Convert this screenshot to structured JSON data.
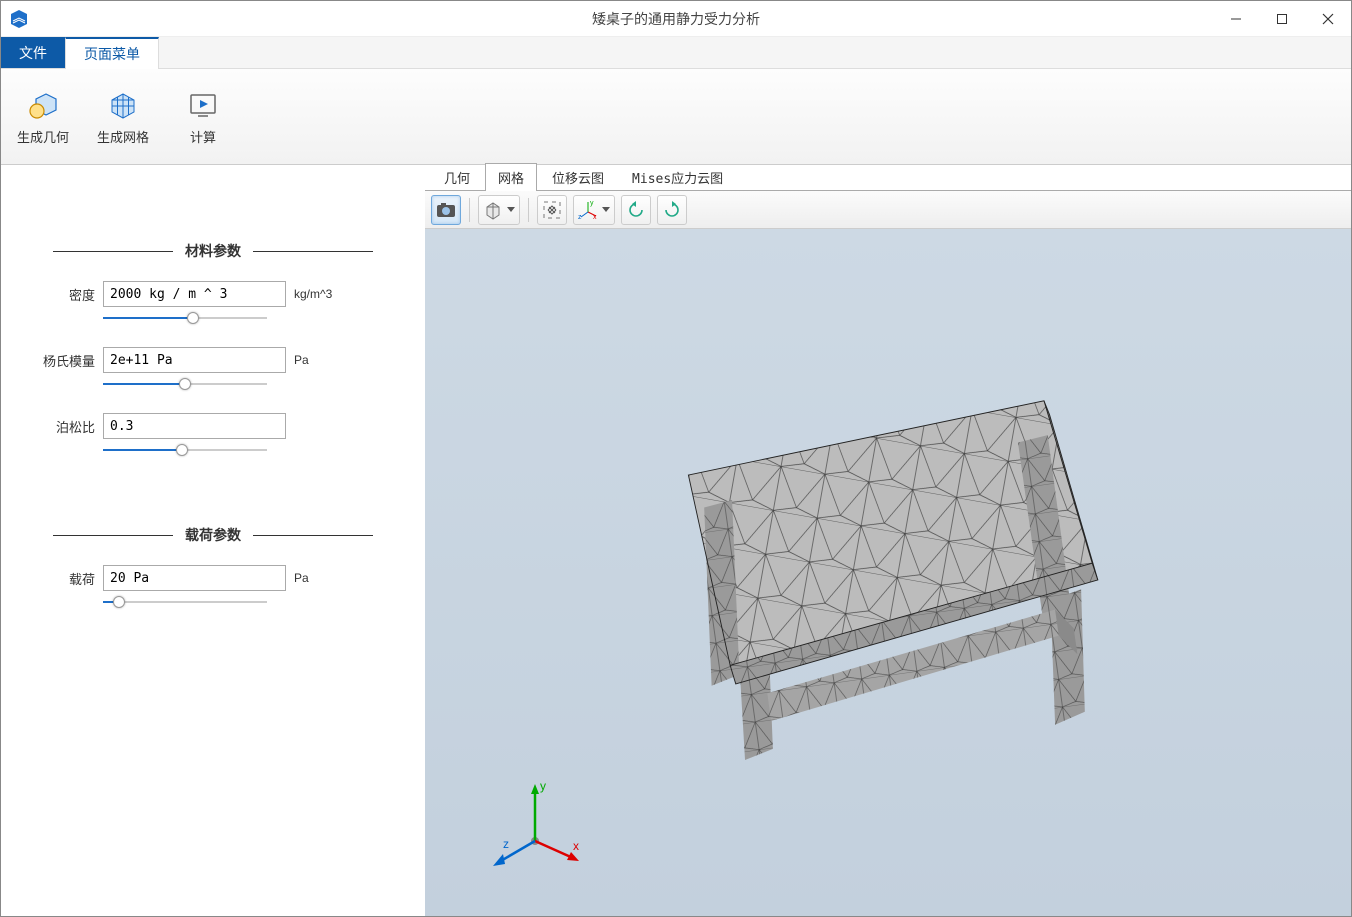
{
  "window": {
    "title": "矮桌子的通用静力受力分析"
  },
  "menu_tabs": {
    "file": "文件",
    "page_menu": "页面菜单"
  },
  "ribbon": {
    "generate_geometry": "生成几何",
    "generate_mesh": "生成网格",
    "compute": "计算"
  },
  "sidebar": {
    "material_params": {
      "header": "材料参数",
      "density": {
        "label": "密度",
        "value": "2000 kg / m ^ 3",
        "unit": "kg/m^3",
        "slider_fill_pct": 55
      },
      "youngs_modulus": {
        "label": "杨氏模量",
        "value": "2e+11 Pa",
        "unit": "Pa",
        "slider_fill_pct": 50
      },
      "poisson_ratio": {
        "label": "泊松比",
        "value": "0.3",
        "unit": "",
        "slider_fill_pct": 48
      }
    },
    "load_params": {
      "header": "载荷参数",
      "load": {
        "label": "载荷",
        "value": "20 Pa",
        "unit": "Pa",
        "slider_fill_pct": 10
      }
    }
  },
  "viewer_tabs": {
    "geometry": "几何",
    "mesh": "网格",
    "displacement": "位移云图",
    "mises": "Mises应力云图",
    "active": "mesh"
  },
  "axis_labels": {
    "x": "x",
    "y": "y",
    "z": "z"
  }
}
